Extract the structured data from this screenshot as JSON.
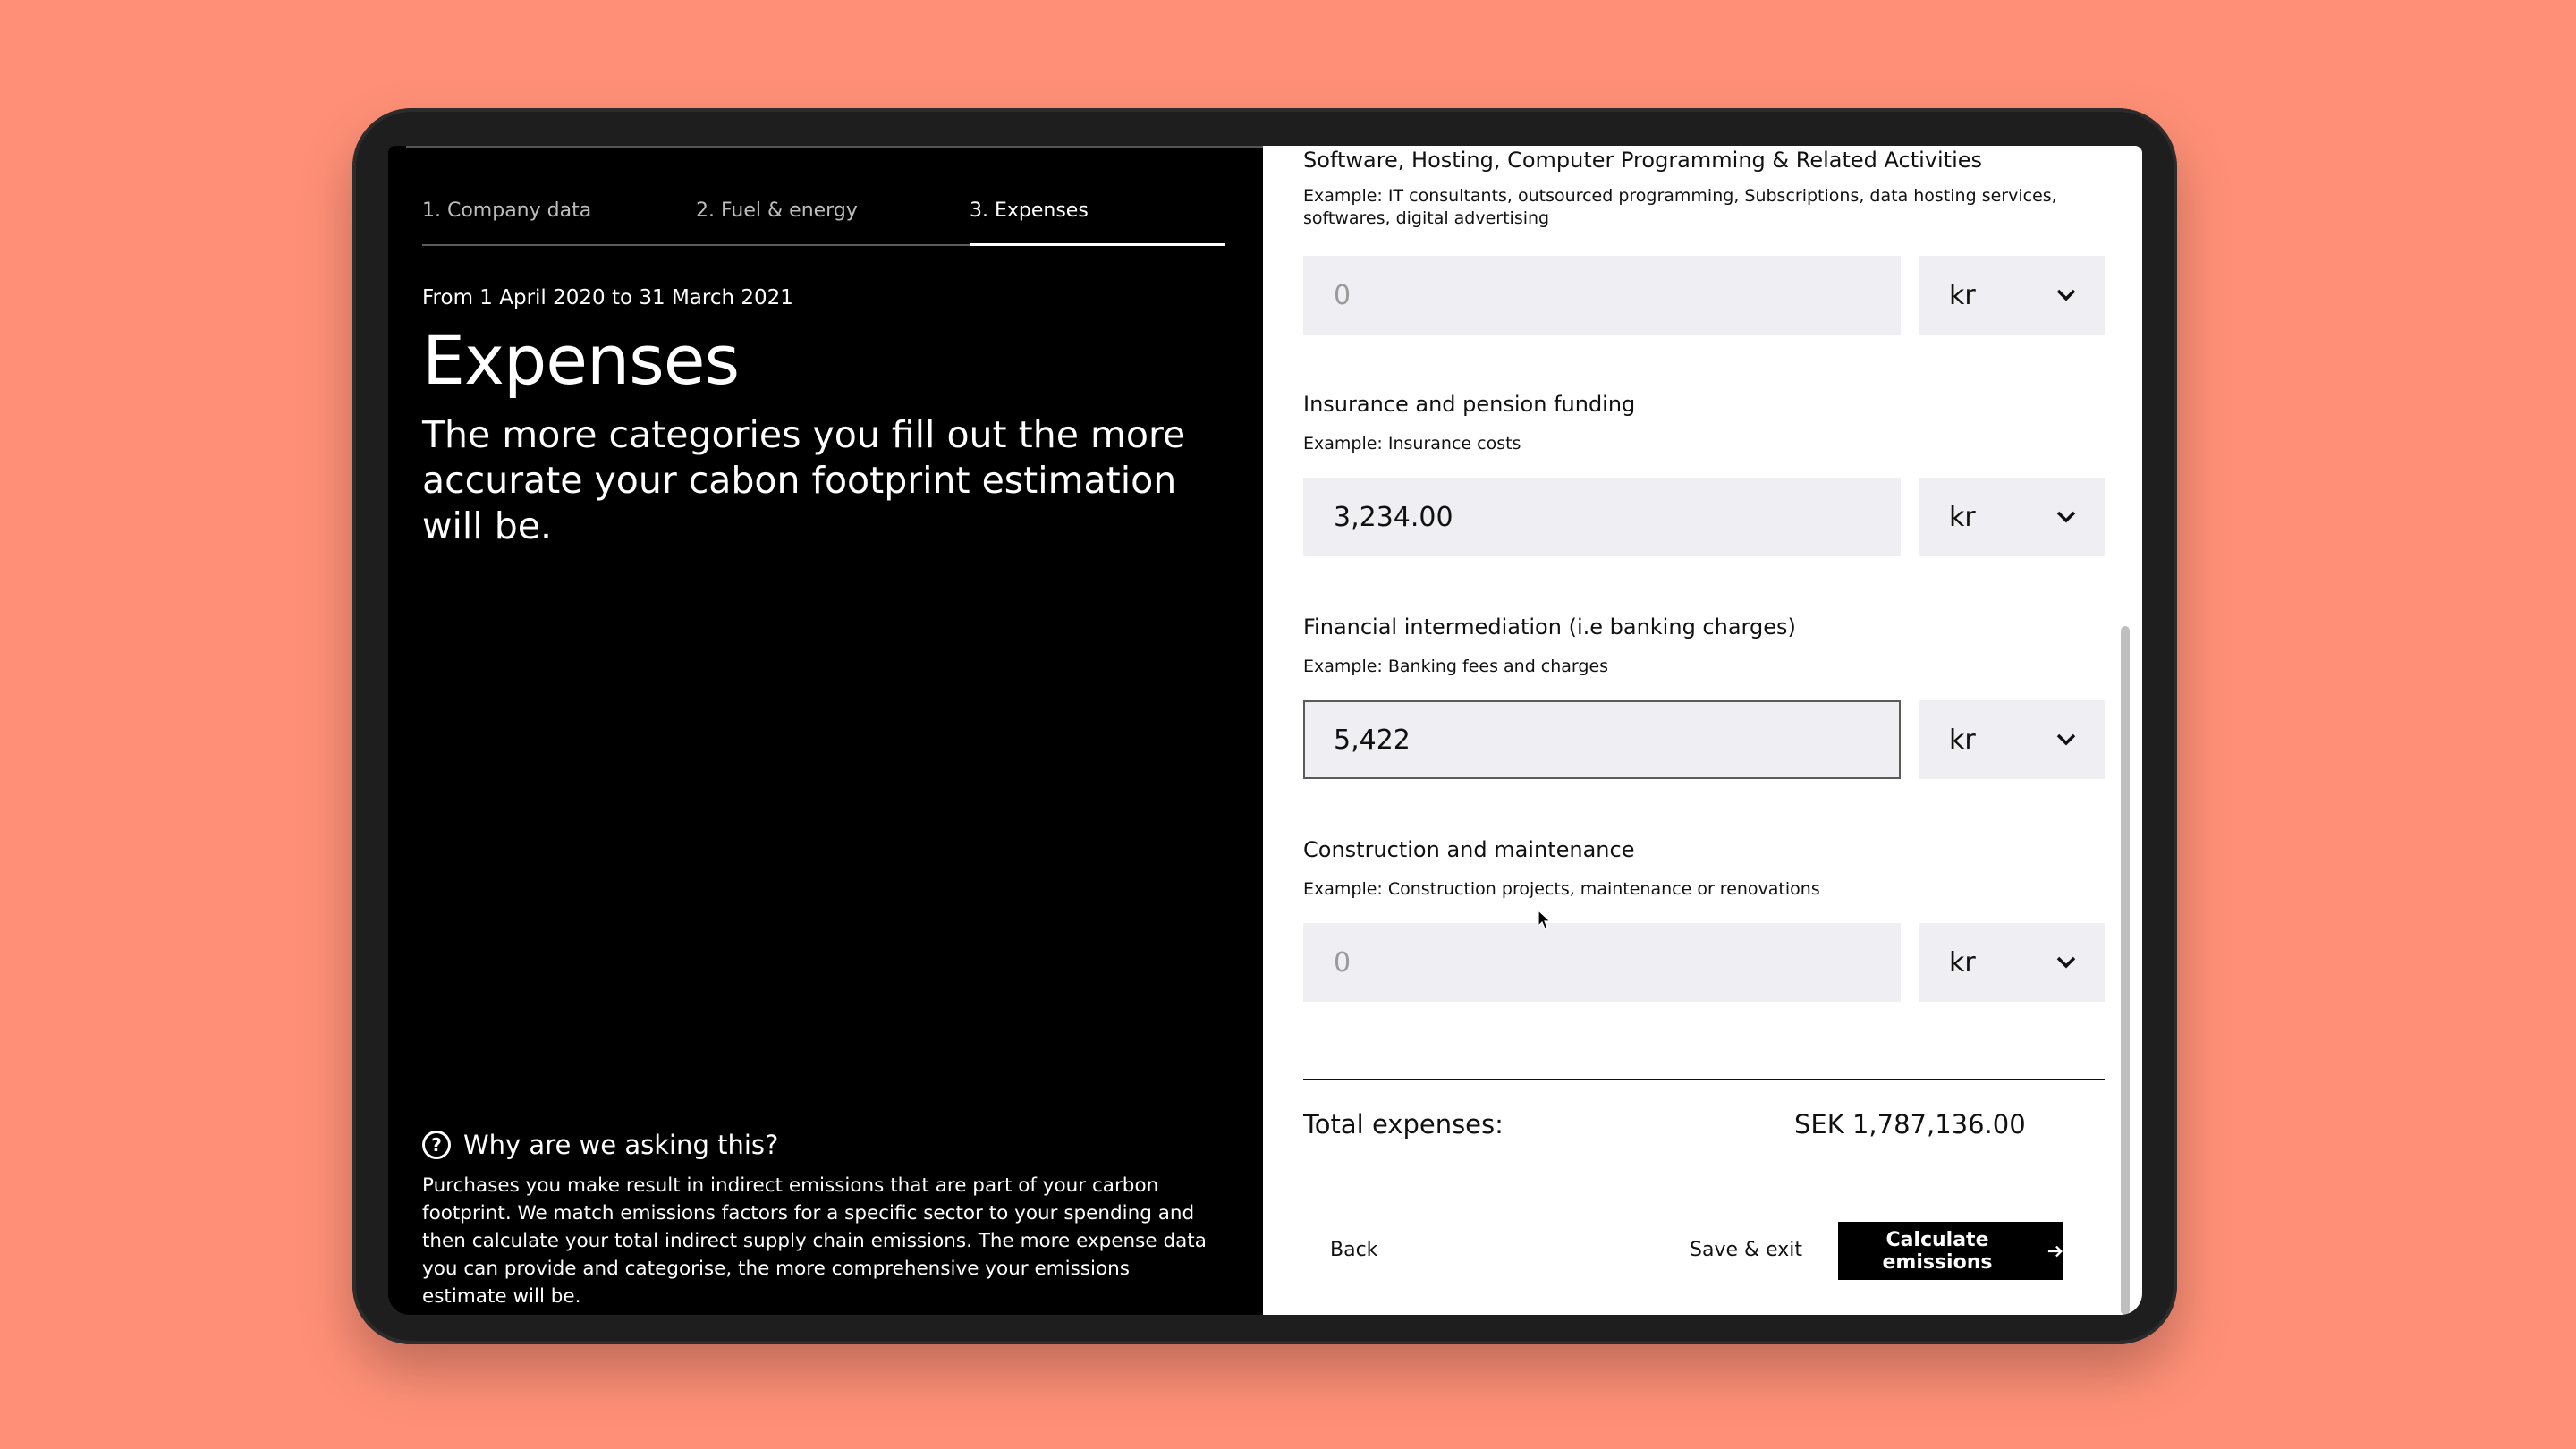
{
  "wizard": {
    "tabs": [
      {
        "label": "1. Company data"
      },
      {
        "label": "2. Fuel & energy"
      },
      {
        "label": "3. Expenses"
      }
    ],
    "period": "From 1 April 2020 to 31 March 2021",
    "title": "Expenses",
    "lead": "The more categories you fill out the more accurate your cabon footprint estimation will be."
  },
  "help": {
    "icon": "question-circle-icon",
    "title": "Why are we asking this?",
    "text": "Purchases you make result in indirect emissions that are part of your carbon footprint. We match emissions factors for a specific sector to your spending and then calculate your total indirect supply chain emissions. The more expense data you can provide and categorise, the more comprehensive your emissions estimate will be."
  },
  "fields": [
    {
      "label": "Software, Hosting, Computer Programming & Related Activities",
      "example": "Example: IT consultants, outsourced programming, Subscriptions, data hosting services, softwares, digital advertising",
      "value": "",
      "placeholder": "0",
      "currency": "kr"
    },
    {
      "label": "Insurance and pension funding",
      "example": "Example: Insurance costs",
      "value": "3,234.00",
      "placeholder": "0",
      "currency": "kr"
    },
    {
      "label": "Financial intermediation (i.e banking charges)",
      "example": "Example: Banking fees and charges",
      "value": "5,422",
      "placeholder": "0",
      "currency": "kr"
    },
    {
      "label": "Construction and maintenance",
      "example": "Example: Construction projects, maintenance or renovations",
      "value": "",
      "placeholder": "0",
      "currency": "kr"
    }
  ],
  "total": {
    "label": "Total expenses:",
    "value": "SEK 1,787,136.00"
  },
  "actions": {
    "back": "Back",
    "save": "Save & exit",
    "calculate": "Calculate emissions"
  },
  "colors": {
    "background": "#FF9077",
    "panel_dark": "#000000",
    "input_bg": "#EFEFF3"
  }
}
